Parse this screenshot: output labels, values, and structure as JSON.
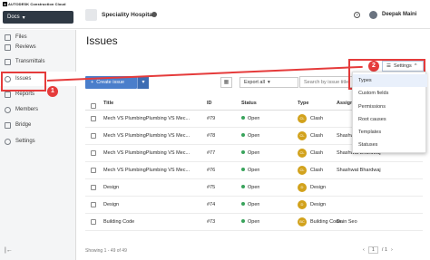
{
  "brand": {
    "mark": "A",
    "text": "AUTODESK Construction Cloud"
  },
  "module": {
    "label": "Docs",
    "chevron": "▾"
  },
  "project": {
    "name": "Speciality Hospital"
  },
  "user": {
    "name": "Deepak Maini",
    "help_glyph": "?"
  },
  "sidebar": {
    "items": [
      {
        "label": "Files"
      },
      {
        "label": "Reviews"
      },
      {
        "label": "Transmittals"
      },
      {
        "label": "Issues"
      },
      {
        "label": "Reports"
      },
      {
        "label": "Members"
      },
      {
        "label": "Bridge"
      },
      {
        "label": "Settings"
      }
    ],
    "collapse_glyph": "|←"
  },
  "page": {
    "title": "Issues"
  },
  "toolbar": {
    "create_label": "Create issue",
    "create_plus": "+",
    "create_drop": "▾",
    "map_glyph": "▦",
    "export_label": "Export all",
    "export_chevron": "▾",
    "search_placeholder": "Search by issue title"
  },
  "table": {
    "headers": {
      "title": "Title",
      "id": "ID",
      "status": "Status",
      "type": "Type",
      "assigned": "Assigned to"
    },
    "rows": [
      {
        "title": "Mech VS PlumbingPlumbing VS Mec...",
        "id": "#79",
        "status": "Open",
        "type": "Clash",
        "badge": "CL",
        "assigned": "",
        "badge_color": "#d2a21c"
      },
      {
        "title": "Mech VS PlumbingPlumbing VS Mec...",
        "id": "#78",
        "status": "Open",
        "type": "Clash",
        "badge": "CL",
        "assigned": "Shashwat Bhardwaj",
        "badge_color": "#d2a21c"
      },
      {
        "title": "Mech VS PlumbingPlumbing VS Mec...",
        "id": "#77",
        "status": "Open",
        "type": "Clash",
        "badge": "CL",
        "assigned": "Shashwat Bhardwaj",
        "badge_color": "#d2a21c"
      },
      {
        "title": "Mech VS PlumbingPlumbing VS Mec...",
        "id": "#76",
        "status": "Open",
        "type": "Clash",
        "badge": "CL",
        "assigned": "Shashwat Bhardwaj",
        "badge_color": "#d2a21c"
      },
      {
        "title": "Design",
        "id": "#75",
        "status": "Open",
        "type": "Design",
        "badge": "D",
        "assigned": "",
        "badge_color": "#d2a21c"
      },
      {
        "title": "Design",
        "id": "#74",
        "status": "Open",
        "type": "Design",
        "badge": "D",
        "assigned": "",
        "badge_color": "#d2a21c"
      },
      {
        "title": "Building Code",
        "id": "#73",
        "status": "Open",
        "type": "Building Code",
        "badge": "BC",
        "assigned": "Dain Seo",
        "badge_color": "#d2a21c"
      }
    ]
  },
  "footer": {
    "showing": "Showing 1 - 49 of 49",
    "page": "1",
    "of": "/ 1",
    "prev": "‹",
    "next": "›"
  },
  "settings": {
    "button_label": "Settings",
    "chevron": "^",
    "menu": [
      {
        "label": "Types"
      },
      {
        "label": "Custom fields"
      },
      {
        "label": "Permissions"
      },
      {
        "label": "Root causes"
      },
      {
        "label": "Templates"
      },
      {
        "label": "Statuses"
      }
    ]
  },
  "callouts": {
    "one": "1",
    "two": "2"
  },
  "colors": {
    "accent": "#4a7ecb",
    "highlight": "#e53b3b",
    "open_status": "#39a35b"
  }
}
